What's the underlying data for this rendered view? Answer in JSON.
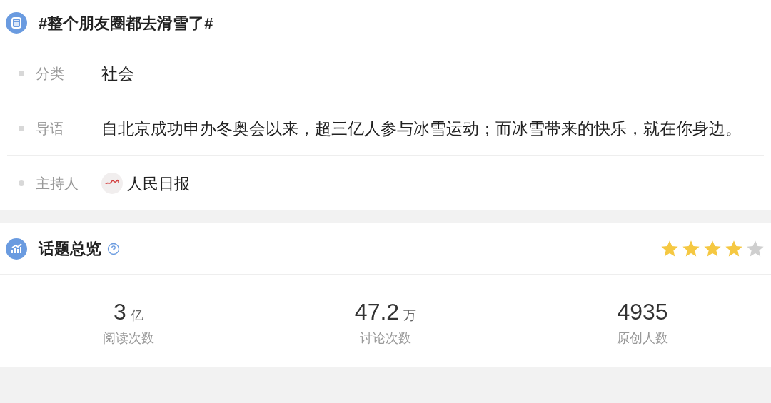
{
  "topic": {
    "title": "#整个朋友圈都去滑雪了#"
  },
  "details": [
    {
      "kind": "text",
      "label": "分类",
      "value": "社会"
    },
    {
      "kind": "text",
      "label": "导语",
      "value": "自北京成功申办冬奥会以来，超三亿人参与冰雪运动；而冰雪带来的快乐，就在你身边。"
    },
    {
      "kind": "host",
      "label": "主持人",
      "value": "人民日报"
    }
  ],
  "overview": {
    "title": "话题总览",
    "stars": 4,
    "stats": [
      {
        "value": "3",
        "unit": "亿",
        "label": "阅读次数"
      },
      {
        "value": "47.2",
        "unit": "万",
        "label": "讨论次数"
      },
      {
        "value": "4935",
        "label": "原创人数"
      }
    ]
  }
}
